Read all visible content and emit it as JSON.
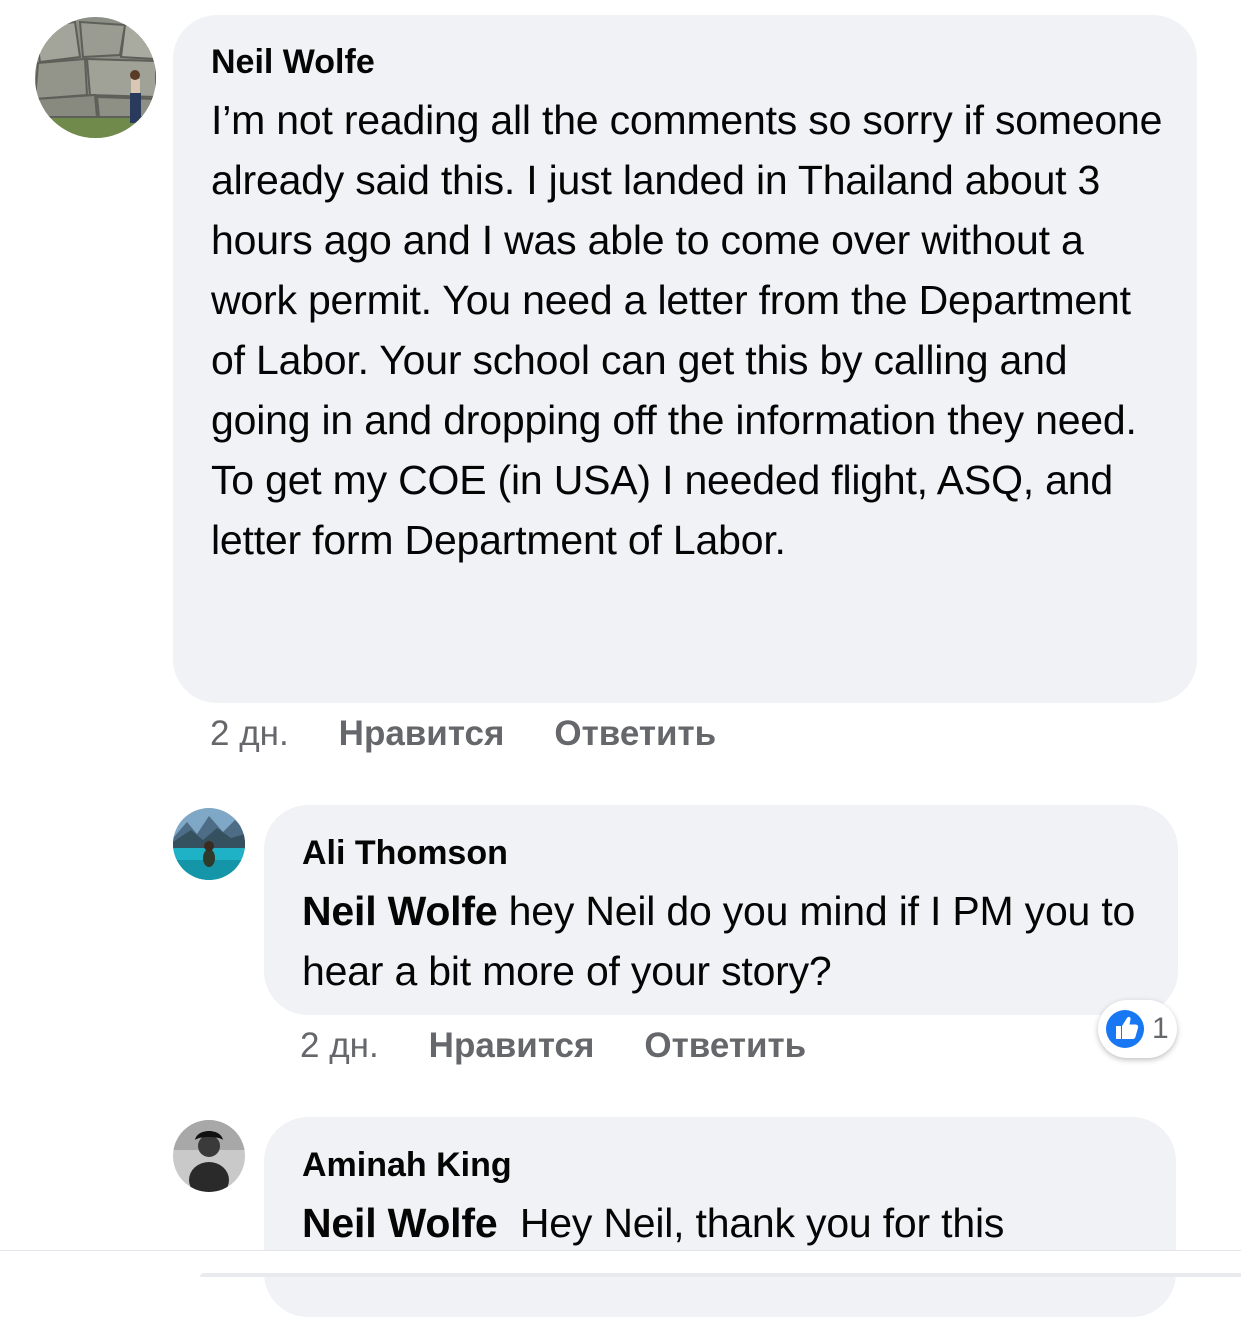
{
  "comments": [
    {
      "author": "Neil Wolfe",
      "text": "I’m not reading all the comments so sorry if someone already said this. I just landed in Thailand about 3 hours ago and I was able to come over without a work permit. You need a letter from the Department of Labor. Your school can get this by calling and going in and dropping off the information they need. To get my COE (in USA) I needed flight, ASQ, and letter form Department of Labor.",
      "time": "2 дн.",
      "like_label": "Нравится",
      "reply_label": "Ответить"
    },
    {
      "author": "Ali Thomson",
      "mention": "Neil Wolfe",
      "text": " hey Neil do you mind if I PM you to hear a bit more of your story?",
      "time": "2 дн.",
      "like_label": "Нравится",
      "reply_label": "Ответить",
      "reaction_count": "1",
      "reaction_icon": "like-icon",
      "reaction_color": "#1877f2"
    },
    {
      "author": "Aminah King",
      "mention": "Neil Wolfe",
      "text": "  Hey Neil, thank you for this"
    }
  ]
}
